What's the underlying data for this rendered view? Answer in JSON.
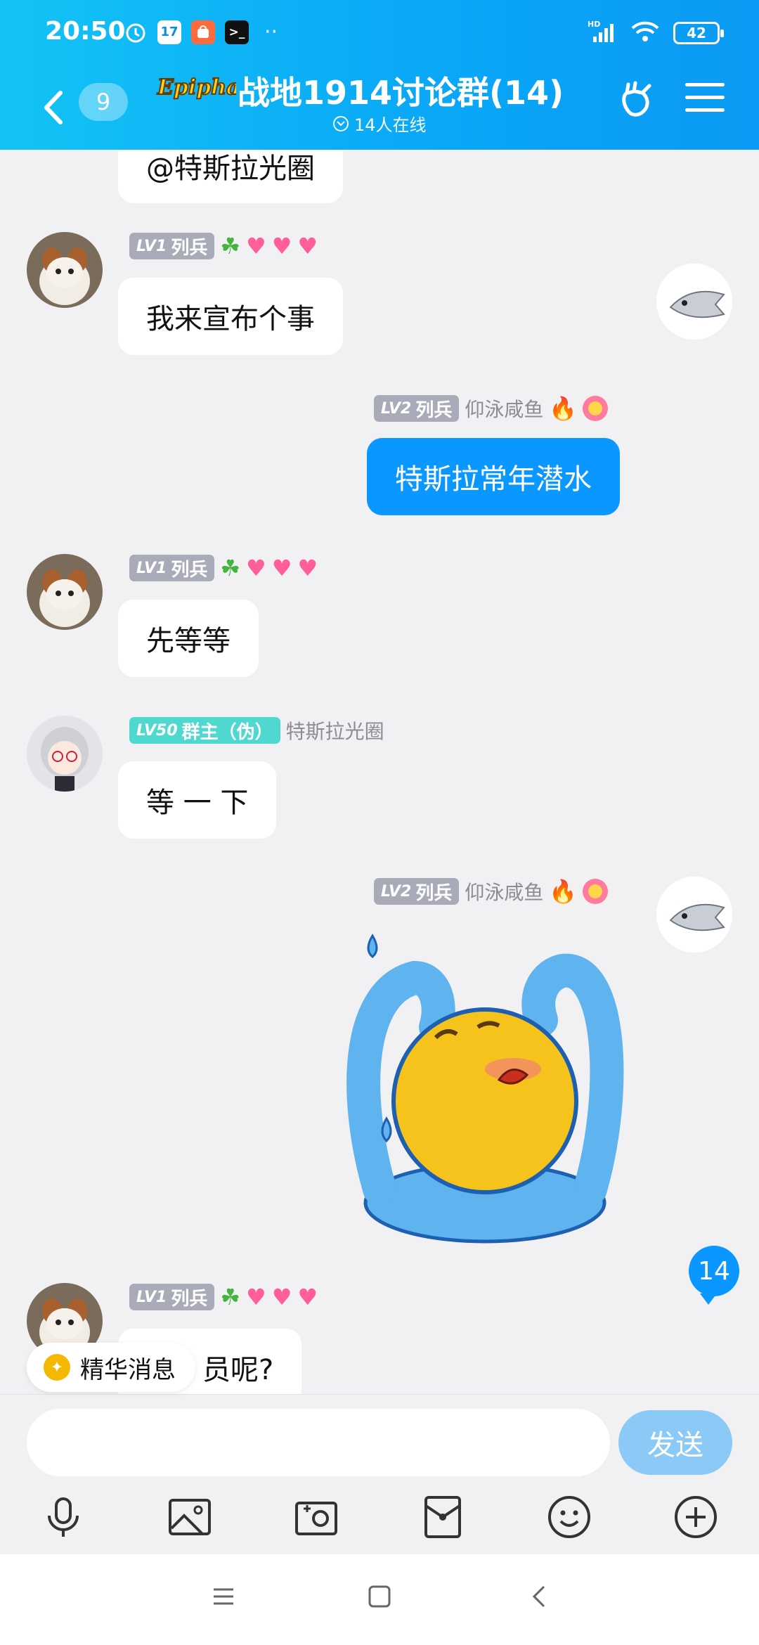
{
  "status_bar": {
    "time": "20:50",
    "calendar_day": "17",
    "battery": "42",
    "network": "HD"
  },
  "header": {
    "unread_count": "9",
    "logo_text": "Epiphany",
    "title": "战地1914讨论群(14)",
    "online_text": "14人在线"
  },
  "messages": [
    {
      "text": "@特斯拉光圈"
    },
    {
      "level": "LV1",
      "rank": "列兵",
      "text": "我来宣布个事"
    },
    {
      "level": "LV2",
      "rank": "列兵",
      "nickname": "仰泳咸鱼",
      "text": "特斯拉常年潜水"
    },
    {
      "level": "LV1",
      "rank": "列兵",
      "text": "先等等"
    },
    {
      "level": "LV50",
      "rank": "群主（伪）",
      "nickname": "特斯拉光圈",
      "text": "等 一 下"
    },
    {
      "level": "LV2",
      "rank": "列兵",
      "nickname": "仰泳咸鱼",
      "sticker": "crying-emoji-sticker"
    },
    {
      "level": "LV1",
      "rank": "列兵",
      "text": "员呢?"
    }
  ],
  "jump_badge": "14",
  "essence_chip": {
    "label": "精华消息"
  },
  "input": {
    "value": "",
    "send_label": "发送"
  },
  "toolbar": [
    "microphone-icon",
    "image-icon",
    "camera-icon",
    "red-packet-icon",
    "emoji-icon",
    "plus-icon"
  ],
  "colors": {
    "header_gradient_start": "#13c3f5",
    "header_gradient_end": "#0b9af5",
    "self_bubble": "#0a97ff",
    "send_button": "#8bcaf6",
    "chat_background": "#f1f1f3",
    "owner_badge": "#4ed8cf",
    "level_badge": "#a9abb8"
  }
}
